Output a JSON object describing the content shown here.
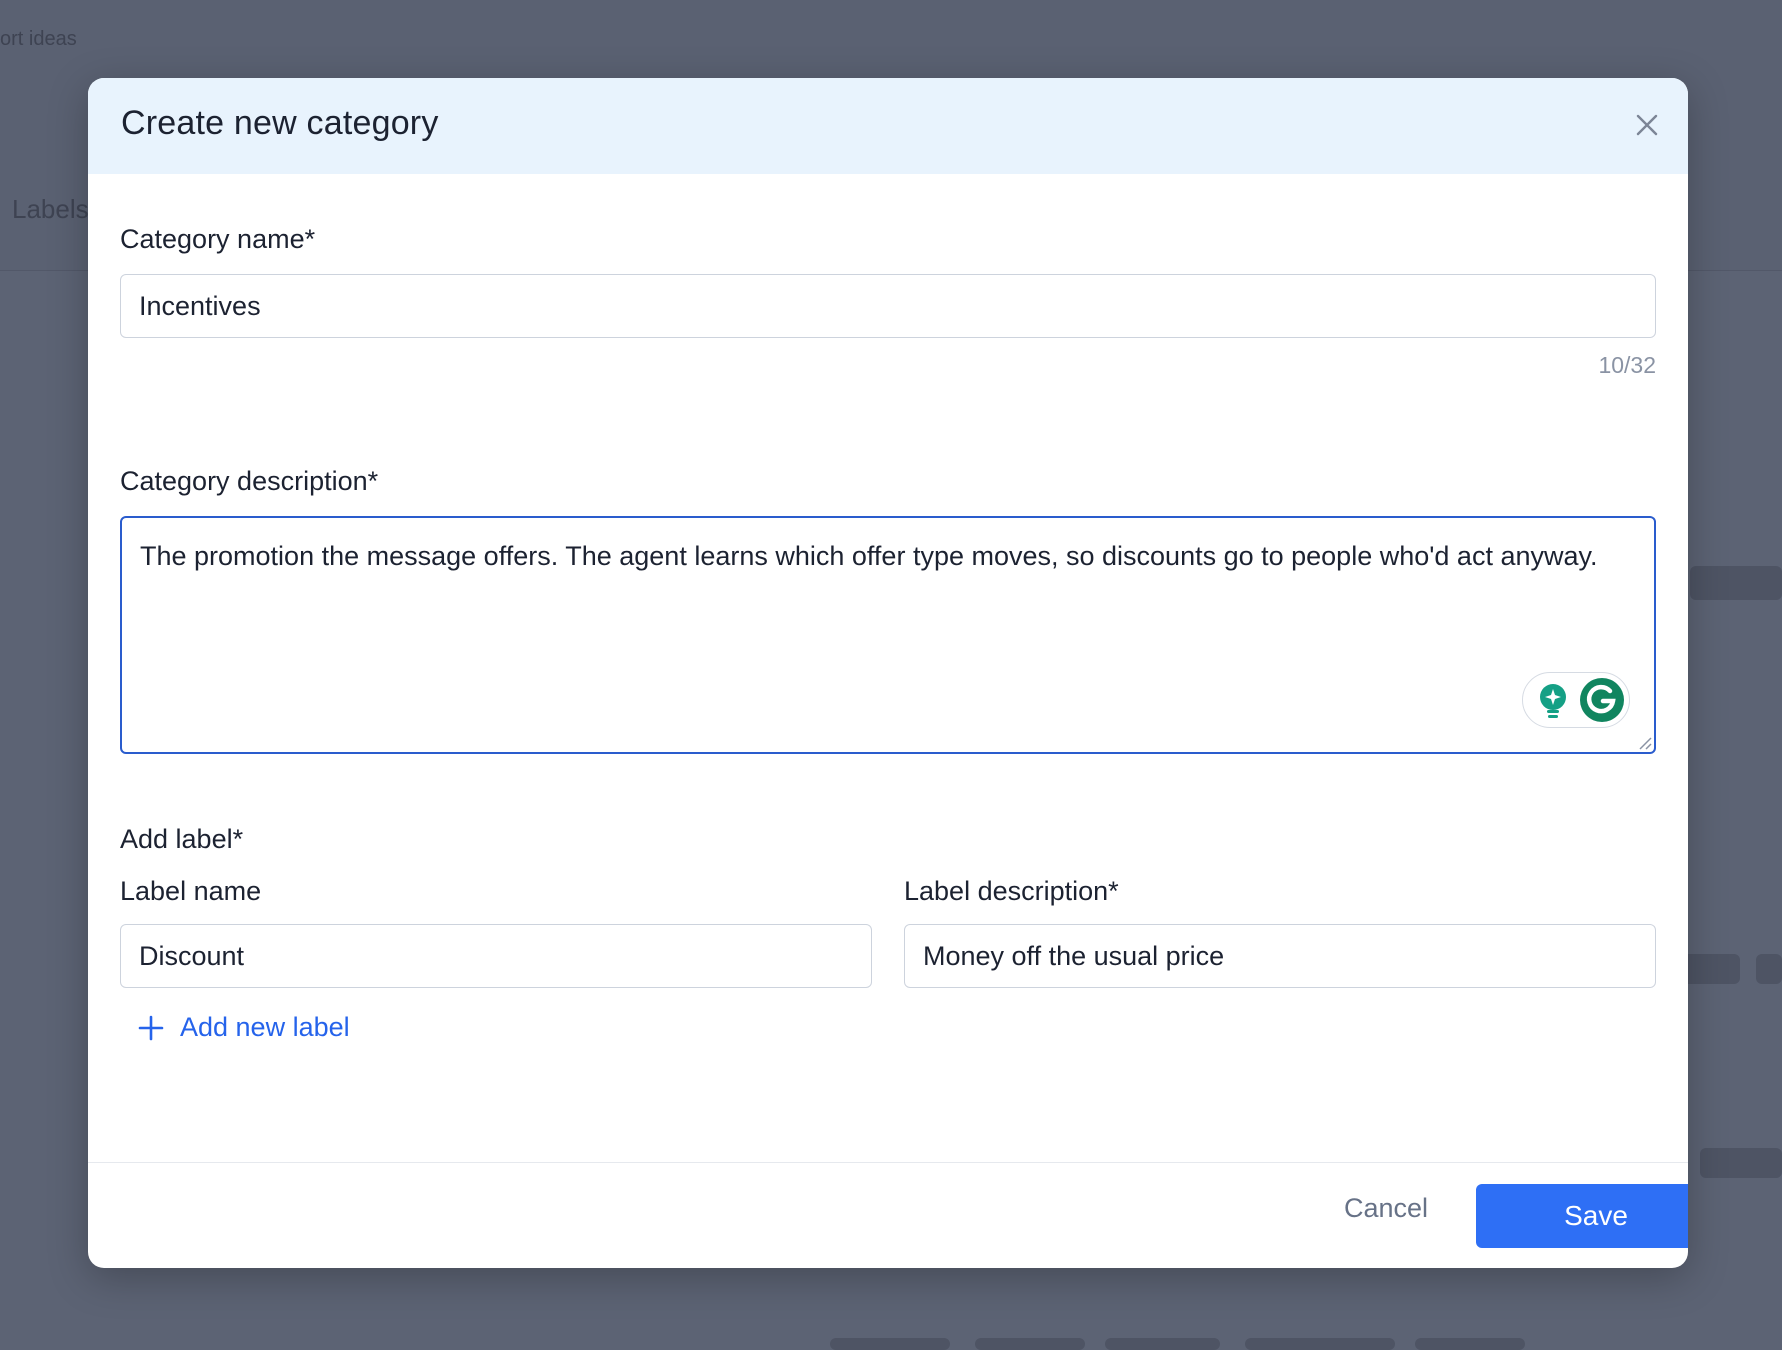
{
  "background": {
    "breadcrumb_text": "ort ideas",
    "heading_text": "Labels"
  },
  "modal": {
    "title": "Create new category",
    "close_icon": "close-icon",
    "category_name": {
      "label": "Category name*",
      "value": "Incentives",
      "char_count": "10/32"
    },
    "category_description": {
      "label": "Category description*",
      "value": "The promotion the message offers. The agent learns which offer type moves, so discounts go to people who'd act anyway."
    },
    "add_label": {
      "section_label": "Add label*",
      "label_name_header": "Label name",
      "label_description_header": "Label description*",
      "label_name_value": "Discount",
      "label_description_value": "Money off the usual price",
      "add_new_label": "Add new label"
    },
    "footer": {
      "cancel_label": "Cancel",
      "save_label": "Save"
    }
  },
  "colors": {
    "overlay": "#5c6374",
    "header_bg": "#e8f3fd",
    "accent": "#2e6ff5",
    "link": "#2563eb",
    "focus_border": "#2a5ccd",
    "grammarly": "#15a085"
  }
}
